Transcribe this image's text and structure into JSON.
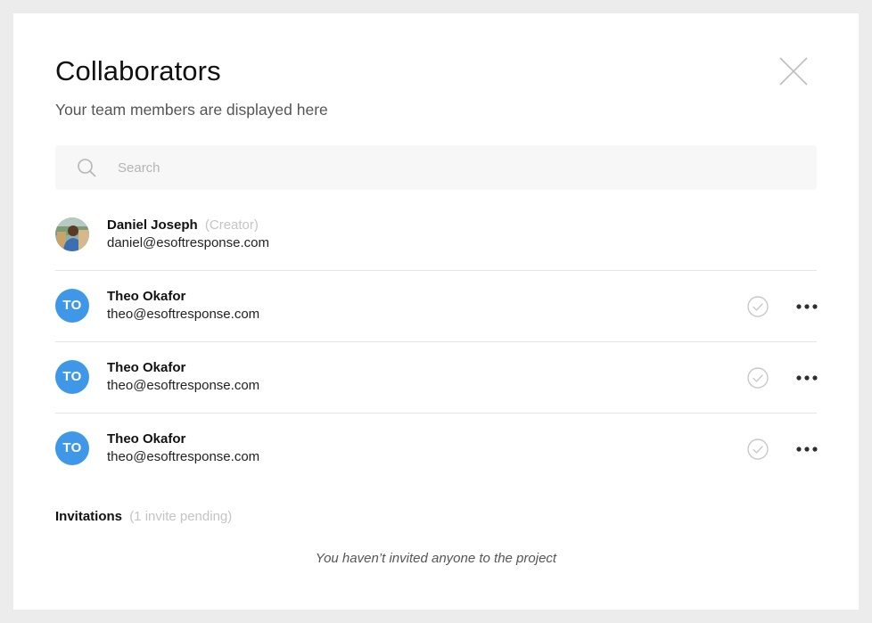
{
  "modal": {
    "title": "Collaborators",
    "subtitle": "Your team members are displayed here",
    "close_icon": "close-icon"
  },
  "search": {
    "placeholder": "Search",
    "value": "",
    "icon": "search-icon"
  },
  "members": [
    {
      "name": "Daniel Joseph",
      "role": "(Creator)",
      "email": "daniel@esoftresponse.com",
      "avatar": "photo"
    },
    {
      "name": "Theo Okafor",
      "initials": "TO",
      "email": "theo@esoftresponse.com",
      "status_icon": "check-circle-icon",
      "menu_icon": "more-horizontal-icon"
    },
    {
      "name": "Theo Okafor",
      "initials": "TO",
      "email": "theo@esoftresponse.com",
      "status_icon": "check-circle-icon",
      "menu_icon": "more-horizontal-icon"
    },
    {
      "name": "Theo Okafor",
      "initials": "TO",
      "email": "theo@esoftresponse.com",
      "status_icon": "check-circle-icon",
      "menu_icon": "more-horizontal-icon"
    }
  ],
  "invitations": {
    "label": "Invitations",
    "count_text": "(1 invite pending)",
    "empty_message": "You haven’t invited anyone to the project"
  },
  "colors": {
    "accent": "#3f97e8",
    "muted_text": "#c4c4c4",
    "background": "#ececec",
    "surface": "#ffffff"
  }
}
